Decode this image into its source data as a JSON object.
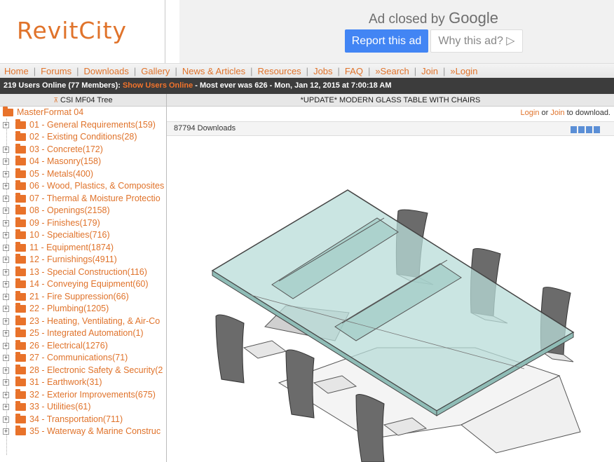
{
  "header": {
    "logo": "RevitCity",
    "ad_closed_text": "Ad closed by",
    "ad_brand": "Google",
    "report_button": "Report this ad",
    "why_button": "Why this ad? ▷"
  },
  "nav": {
    "items": [
      "Home",
      "Forums",
      "Downloads",
      "Gallery",
      "News & Articles",
      "Resources",
      "Jobs",
      "FAQ",
      "»Search",
      "Join",
      "»Login"
    ]
  },
  "status": {
    "users": "219 Users Online (77 Members):",
    "show_users": "Show Users Online",
    "record": "- Most ever was 626 - Mon, Jan 12, 2015 at 7:00:18 AM"
  },
  "sidebar": {
    "title": "CSI MF04 Tree",
    "root": "MasterFormat 04",
    "items": [
      "01 - General Requirements(159)",
      "02 - Existing Conditions(28)",
      "03 - Concrete(172)",
      "04 - Masonry(158)",
      "05 - Metals(400)",
      "06 - Wood, Plastics, & Composites",
      "07 - Thermal & Moisture Protectio",
      "08 - Openings(2158)",
      "09 - Finishes(179)",
      "10 - Specialties(716)",
      "11 - Equipment(1874)",
      "12 - Furnishings(4911)",
      "13 - Special Construction(116)",
      "14 - Conveying Equipment(60)",
      "21 - Fire Suppression(66)",
      "22 - Plumbing(1205)",
      "23 - Heating, Ventilating, & Air-Co",
      "25 - Integrated Automation(1)",
      "26 - Electrical(1276)",
      "27 - Communications(71)",
      "28 - Electronic Safety & Security(2",
      "31 - Earthwork(31)",
      "32 - Exterior Improvements(675)",
      "33 - Utilities(61)",
      "34 - Transportation(711)",
      "35 - Waterway & Marine Construc"
    ]
  },
  "main": {
    "title": "*UPDATE* MODERN GLASS TABLE WITH CHAIRS",
    "login": "Login",
    "or": "or",
    "join": "Join",
    "to_download": "to download.",
    "downloads": "87794 Downloads"
  }
}
